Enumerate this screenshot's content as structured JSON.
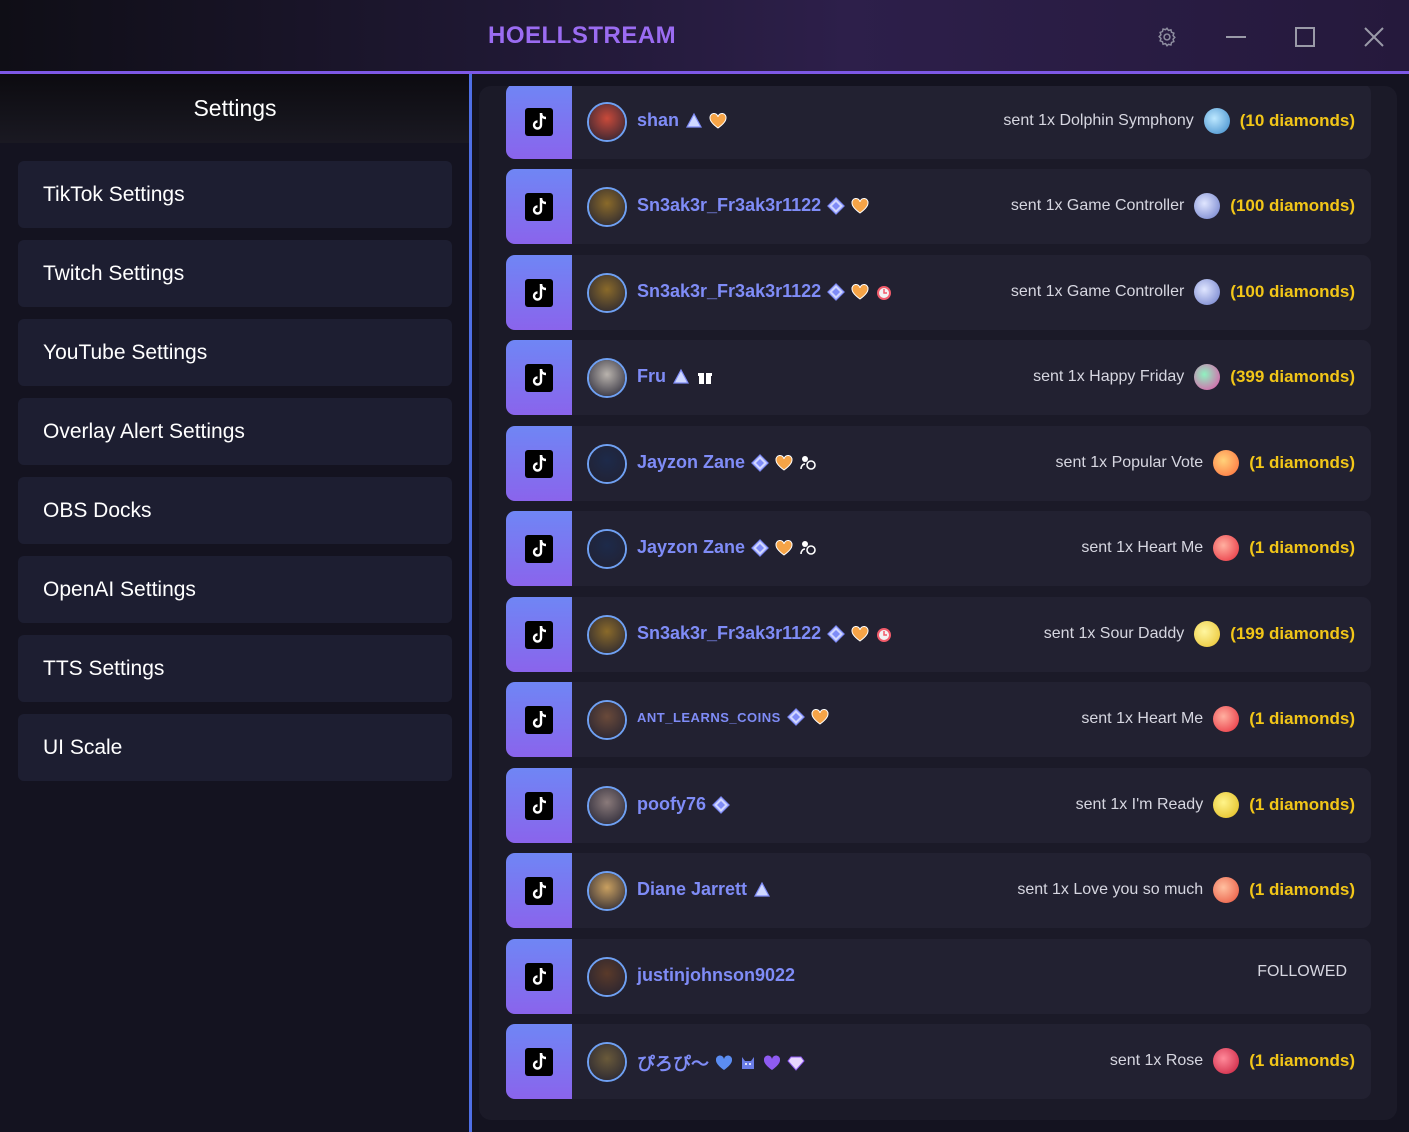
{
  "app": {
    "title": "HOELLSTREAM"
  },
  "sidebar": {
    "title": "Settings",
    "items": [
      {
        "label": "TikTok Settings"
      },
      {
        "label": "Twitch Settings"
      },
      {
        "label": "YouTube Settings"
      },
      {
        "label": "Overlay Alert Settings"
      },
      {
        "label": "OBS Docks"
      },
      {
        "label": "OpenAI Settings"
      },
      {
        "label": "TTS Settings"
      },
      {
        "label": "UI Scale"
      }
    ]
  },
  "colors": {
    "accent": "#7d58e6",
    "username": "#7f8cf7",
    "diamonds": "#f2c618",
    "row_bg": "#222131"
  },
  "feed": [
    {
      "platform": "tiktok-icon",
      "username": "shan",
      "badges": [
        "triangle-badge-icon",
        "heart-badge-icon"
      ],
      "text": "sent 1x Dolphin Symphony",
      "gift_icon": "dolphin-gift-icon",
      "diamonds": "(10 diamonds)",
      "avatar_color": "#c94a3a"
    },
    {
      "platform": "tiktok-icon",
      "username": "Sn3ak3r_Fr3ak3r1122",
      "badges": [
        "diamond-badge-icon",
        "heart-badge-icon"
      ],
      "text": "sent 1x Game Controller",
      "gift_icon": "controller-gift-icon",
      "diamonds": "(100 diamonds)",
      "avatar_color": "#8a6a2a"
    },
    {
      "platform": "tiktok-icon",
      "username": "Sn3ak3r_Fr3ak3r1122",
      "badges": [
        "diamond-badge-icon",
        "heart-badge-icon",
        "alarm-badge-icon"
      ],
      "text": "sent 1x Game Controller",
      "gift_icon": "controller-gift-icon",
      "diamonds": "(100 diamonds)",
      "avatar_color": "#8a6a2a"
    },
    {
      "platform": "tiktok-icon",
      "username": "Fru",
      "badges": [
        "triangle-badge-icon",
        "gift-badge-icon"
      ],
      "text": "sent 1x Happy Friday",
      "gift_icon": "happy-friday-gift-icon",
      "diamonds": "(399 diamonds)",
      "avatar_color": "#b9b3ad"
    },
    {
      "platform": "tiktok-icon",
      "username": "Jayzon Zane",
      "badges": [
        "diamond-badge-icon",
        "heart-badge-icon",
        "people-badge-icon"
      ],
      "text": "sent 1x Popular Vote",
      "gift_icon": "popular-vote-gift-icon",
      "diamonds": "(1 diamonds)",
      "avatar_color": "#1d2a4a"
    },
    {
      "platform": "tiktok-icon",
      "username": "Jayzon Zane",
      "badges": [
        "diamond-badge-icon",
        "heart-badge-icon",
        "people-badge-icon"
      ],
      "text": "sent 1x Heart Me",
      "gift_icon": "heart-me-gift-icon",
      "diamonds": "(1 diamonds)",
      "avatar_color": "#1d2a4a"
    },
    {
      "platform": "tiktok-icon",
      "username": "Sn3ak3r_Fr3ak3r1122",
      "badges": [
        "diamond-badge-icon",
        "heart-badge-icon",
        "alarm-badge-icon"
      ],
      "text": "sent 1x Sour Daddy",
      "gift_icon": "sour-daddy-gift-icon",
      "diamonds": "(199 diamonds)",
      "avatar_color": "#8a6a2a"
    },
    {
      "platform": "tiktok-icon",
      "username": "ANT_LEARNS_COINS",
      "badges": [
        "diamond-badge-icon",
        "heart-badge-icon"
      ],
      "text": "sent 1x Heart Me",
      "gift_icon": "heart-me-gift-icon",
      "diamonds": "(1 diamonds)",
      "avatar_color": "#6a4a3a"
    },
    {
      "platform": "tiktok-icon",
      "username": "poofy76",
      "badges": [
        "diamond-badge-icon"
      ],
      "text": "sent 1x I'm Ready",
      "gift_icon": "im-ready-gift-icon",
      "diamonds": "(1 diamonds)",
      "avatar_color": "#8a7a7a"
    },
    {
      "platform": "tiktok-icon",
      "username": "Diane Jarrett",
      "badges": [
        "triangle-badge-icon"
      ],
      "text": "sent 1x Love you so much",
      "gift_icon": "love-you-gift-icon",
      "diamonds": "(1 diamonds)",
      "avatar_color": "#c9a060"
    },
    {
      "platform": "tiktok-icon",
      "username": "justinjohnson9022",
      "badges": [],
      "text": "FOLLOWED",
      "gift_icon": "",
      "diamonds": "",
      "avatar_color": "#5a3a2a"
    },
    {
      "platform": "tiktok-icon",
      "username": "ぴろぴ〜",
      "badges": [
        "blue-heart-badge-icon",
        "cat-badge-icon",
        "purple-heart-badge-icon",
        "gem-badge-icon"
      ],
      "text": "sent 1x Rose",
      "gift_icon": "rose-gift-icon",
      "diamonds": "(1 diamonds)",
      "avatar_color": "#6a5a3a"
    }
  ]
}
